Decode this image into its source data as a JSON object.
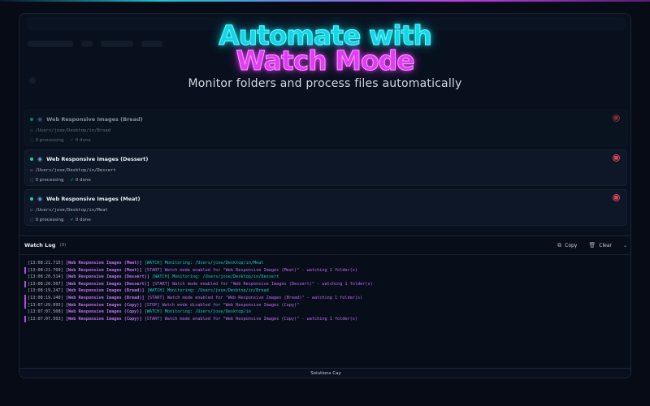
{
  "hero": {
    "line1": "Automate with",
    "line2": "Watch Mode",
    "subtitle": "Monitor folders and process files automatically"
  },
  "watchers": [
    {
      "name": "Web Responsive Images (Bread)",
      "path": "/Users/jose/Desktop/in/Bread",
      "processing": "0 processing",
      "done": "0 done",
      "dimmed": true
    },
    {
      "name": "Web Responsive Images (Dessert)",
      "path": "/Users/jose/Desktop/in/Dessert",
      "processing": "0 processing",
      "done": "0 done",
      "dimmed": false
    },
    {
      "name": "Web Responsive Images (Meat)",
      "path": "/Users/jose/Desktop/in/Meat",
      "processing": "0 processing",
      "done": "0 done",
      "dimmed": false
    }
  ],
  "log": {
    "title": "Watch Log",
    "count": "(9)",
    "copy_label": "Copy",
    "clear_label": "Clear",
    "entries": [
      {
        "ts": "[13:08:21.715]",
        "src": "[Web Responsive Images (Meat)]",
        "tag": "[WATCH]",
        "msg": "Monitoring: /Users/jose/Desktop/in/Meat",
        "kind": "watch",
        "bar": false
      },
      {
        "ts": "[13:08:21.709]",
        "src": "[Web Responsive Images (Meat)]",
        "tag": "[START]",
        "msg": "Watch mode enabled for \"Web Responsive Images (Meat)\" - watching 1 folder(s)",
        "kind": "start",
        "bar": true
      },
      {
        "ts": "[13:08:20.514]",
        "src": "[Web Responsive Images (Dessert)]",
        "tag": "[WATCH]",
        "msg": "Monitoring: /Users/jose/Desktop/in/Dessert",
        "kind": "watch",
        "bar": false
      },
      {
        "ts": "[13:08:20.507]",
        "src": "[Web Responsive Images (Dessert)]",
        "tag": "[START]",
        "msg": "Watch mode enabled for \"Web Responsive Images (Dessert)\" - watching 1 folder(s)",
        "kind": "start",
        "bar": true
      },
      {
        "ts": "[13:08:19.247]",
        "src": "[Web Responsive Images (Bread)]",
        "tag": "[WATCH]",
        "msg": "Monitoring: /Users/jose/Desktop/in/Bread",
        "kind": "watch",
        "bar": false
      },
      {
        "ts": "[13:08:19.240]",
        "src": "[Web Responsive Images (Bread)]",
        "tag": "[START]",
        "msg": "Watch mode enabled for \"Web Responsive Images (Bread)\" - watching 1 folder(s)",
        "kind": "start",
        "bar": true
      },
      {
        "ts": "[13:07:29.095]",
        "src": "[Web Responsive Images (Copy)]",
        "tag": "[STOP]",
        "msg": "Watch mode disabled for \"Web Responsive Images (Copy)\"",
        "kind": "stop",
        "bar": true
      },
      {
        "ts": "[13:07:07.508]",
        "src": "[Web Responsive Images (Copy)]",
        "tag": "[WATCH]",
        "msg": "Monitoring: /Users/jose/Desktop/in",
        "kind": "watch",
        "bar": false
      },
      {
        "ts": "[13:07:07.503]",
        "src": "[Web Responsive Images (Copy)]",
        "tag": "[START]",
        "msg": "Watch mode enabled for \"Web Responsive Images (Copy)\" - watching 1 folder(s)",
        "kind": "start",
        "bar": true
      }
    ]
  },
  "footer": {
    "text": "Solutions Cay"
  },
  "colors": {
    "accent_cyan": "#12d8e6",
    "accent_magenta": "#e23cf4",
    "status_green": "#1ed69a",
    "stop_red": "#e0445a"
  },
  "icons": {
    "watch": "eye-icon",
    "stop": "stop-circle-icon",
    "folder": "folder-icon",
    "processing": "spinner-icon",
    "done": "check-circle-icon",
    "copy": "copy-icon",
    "clear": "trash-icon",
    "collapse": "chevron-down-icon"
  }
}
